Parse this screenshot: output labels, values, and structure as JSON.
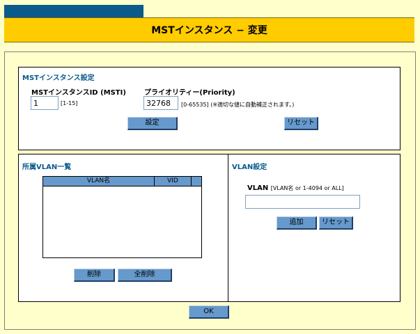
{
  "page": {
    "title": "MSTインスタンス − 変更"
  },
  "mst_settings": {
    "section_title": "MSTインスタンス設定",
    "instance_id_label": "MSTインスタンスID (MSTI)",
    "instance_id_value": "1",
    "instance_id_range": "[1-15]",
    "priority_label": "プライオリティー(Priority)",
    "priority_value": "32768",
    "priority_range": "[0-65535] (※適切な値に自動補正されます。)",
    "set_button": "設定",
    "reset_button": "リセット"
  },
  "vlan_list": {
    "section_title": "所属VLAN一覧",
    "col_name": "VLAN名",
    "col_vid": "VID",
    "delete_button": "削除",
    "delete_all_button": "全削除"
  },
  "vlan_settings": {
    "section_title": "VLAN設定",
    "vlan_label": "VLAN",
    "vlan_hint": "[VLAN名 or 1-4094 or ALL]",
    "vlan_value": "",
    "add_button": "追加",
    "reset_button": "リセット"
  },
  "footer": {
    "ok_button": "OK"
  }
}
